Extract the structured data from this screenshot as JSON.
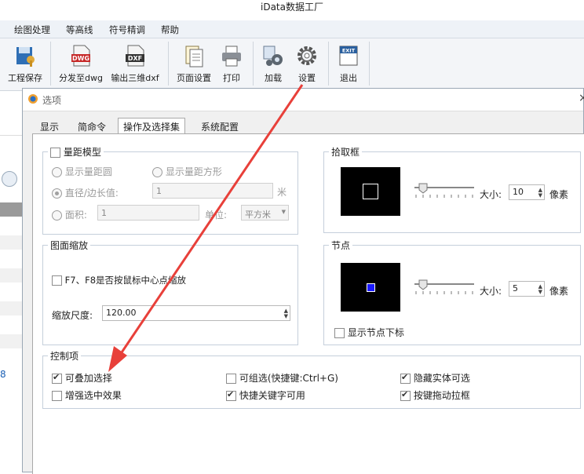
{
  "app": {
    "title": "iData数据工厂"
  },
  "menu": [
    "绘图处理",
    "等高线",
    "符号精调",
    "帮助"
  ],
  "ribbon": [
    {
      "label": "工程保存",
      "icon": "folder-save-icon"
    },
    {
      "label": "分发至dwg",
      "icon": "dwg-icon",
      "badge": "DWG"
    },
    {
      "label": "输出三维dxf",
      "icon": "dxf-icon",
      "badge": "DXF"
    },
    {
      "label": "页面设置",
      "icon": "page-setup-icon"
    },
    {
      "label": "打印",
      "icon": "printer-icon"
    },
    {
      "label": "加载",
      "icon": "load-gears-icon"
    },
    {
      "label": "设置",
      "icon": "gear-icon"
    },
    {
      "label": "退出",
      "icon": "exit-icon",
      "badge": "EXIT"
    }
  ],
  "left_panel": {
    "number": "8"
  },
  "dialog": {
    "title": "选项",
    "tabs": [
      "显示",
      "简命令",
      "操作及选择集",
      "系统配置"
    ],
    "active_tab": "操作及选择集",
    "measure": {
      "title": "量距模型",
      "option_circle": "显示量距圆",
      "option_square": "显示量距方形",
      "option_diameter": "直径/边长值:",
      "diameter_value": "1",
      "diameter_unit": "米",
      "option_area": "面积:",
      "area_value": "1",
      "unit_label": "单位:",
      "unit_value": "平方米"
    },
    "zoom": {
      "title": "图面缩放",
      "f7f8_label": "F7、F8是否按鼠标中心点缩放",
      "scale_label": "缩放尺度:",
      "scale_value": "120.00"
    },
    "pickbox": {
      "title": "拾取框",
      "size_label": "大小:",
      "size_value": "10",
      "unit": "像素"
    },
    "node": {
      "title": "节点",
      "size_label": "大小:",
      "size_value": "5",
      "unit": "像素",
      "show_index_label": "显示节点下标"
    },
    "control": {
      "title": "控制项",
      "stackable_select": "可叠加选择",
      "enhance_effect": "增强选中效果",
      "group_select": "可组选(快捷键:Ctrl+G)",
      "shortcut_enabled": "快捷关键字可用",
      "hide_entity_select": "隐藏实体可选",
      "drag_box": "按键拖动拉框"
    }
  },
  "colors": {
    "annotation_arrow": "#e8403a",
    "node_marker": "#1a1aff"
  }
}
